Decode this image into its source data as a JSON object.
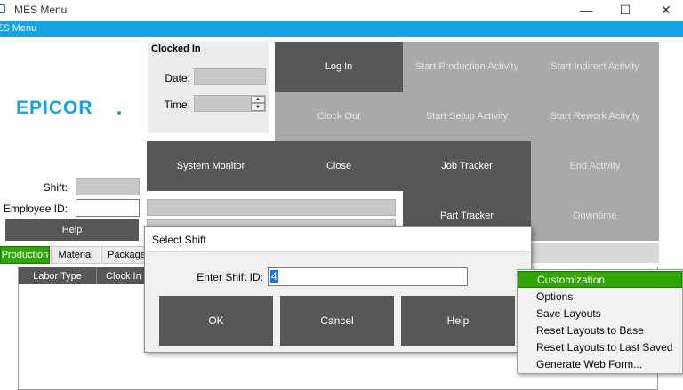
{
  "window": {
    "title": "MES Menu",
    "minimize_glyph": "—",
    "maximize_glyph": "☐",
    "close_glyph": "✕"
  },
  "menu_strip": {
    "label": "ES Menu"
  },
  "logo": {
    "text": "EPICOR"
  },
  "clocked_in": {
    "heading": "Clocked In",
    "date_label": "Date:",
    "date_value": "",
    "time_label": "Time:",
    "time_value": ""
  },
  "left_fields": {
    "shift_label": "Shift:",
    "shift_value": "",
    "employee_label": "Employee ID:",
    "employee_value": "",
    "help_label": "Help"
  },
  "action_buttons": {
    "log_in": "Log In",
    "start_production": "Start Production Activity",
    "start_indirect": "Start Indirect Activity",
    "clock_out": "Clock Out",
    "start_setup": "Start Setup Activity",
    "start_rework": "Start Rework Activity",
    "system_monitor": "System Monitor",
    "close": "Close",
    "job_tracker": "Job Tracker",
    "end_activity": "End Activity",
    "part_tracker": "Part Tracker",
    "downtime": "Downtime"
  },
  "tabs": [
    {
      "label": "Production",
      "active": true
    },
    {
      "label": "Material",
      "active": false
    },
    {
      "label": "Package",
      "active": false
    }
  ],
  "grid_columns": [
    "Labor Type",
    "Clock In"
  ],
  "dialog": {
    "title": "Select Shift",
    "field_label": "Enter Shift ID:",
    "field_value": "4",
    "ok": "OK",
    "cancel": "Cancel",
    "help": "Help"
  },
  "context_menu": {
    "items": [
      {
        "label": "Customization",
        "highlighted": true
      },
      {
        "label": "Options",
        "highlighted": false
      },
      {
        "label": "Save Layouts",
        "highlighted": false
      },
      {
        "label": "Reset Layouts to Base",
        "highlighted": false
      },
      {
        "label": "Reset Layouts to Last Saved",
        "highlighted": false
      },
      {
        "label": "Generate Web Form...",
        "highlighted": false
      }
    ]
  },
  "colors": {
    "accent_blue": "#1aa1e3",
    "dark_button": "#575757",
    "disabled_button": "#a9a9a9",
    "active_tab": "#2fa600",
    "highlight": "#2fa600"
  }
}
